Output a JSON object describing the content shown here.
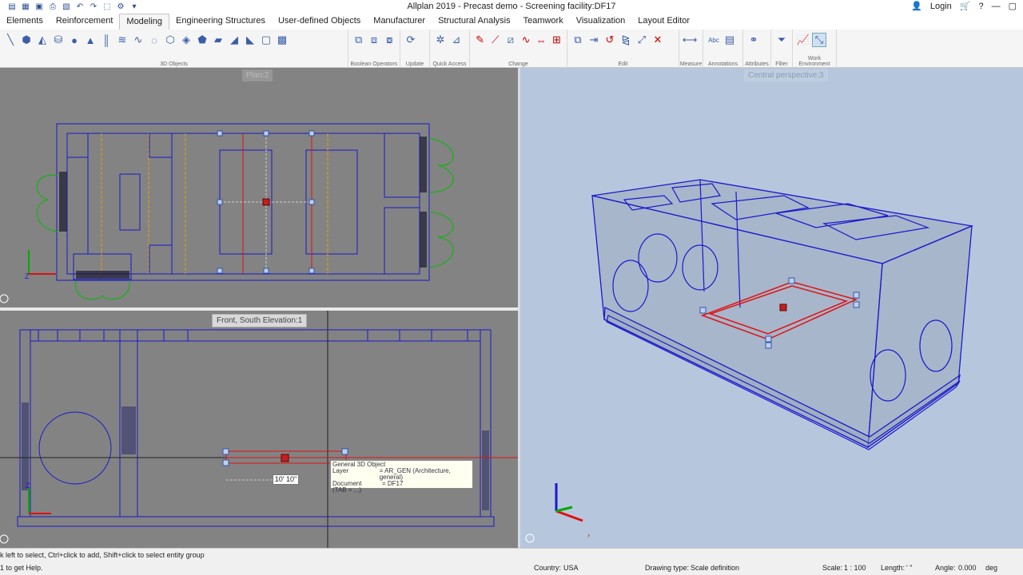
{
  "window": {
    "title": "Allplan 2019 - Precast demo - Screening facility:DF17",
    "login_label": "Login"
  },
  "menu": {
    "tabs": [
      "Elements",
      "Reinforcement",
      "Modeling",
      "Engineering Structures",
      "User-defined Objects",
      "Manufacturer",
      "Structural Analysis",
      "Teamwork",
      "Visualization",
      "Layout Editor"
    ],
    "active": "Modeling"
  },
  "ribbon": {
    "groups": [
      "3D Objects",
      "Boolean Operators",
      "Update",
      "Quick Access",
      "Change",
      "Edit",
      "Measure",
      "Annotations",
      "Attributes",
      "Filter",
      "Work Environment"
    ]
  },
  "viewports": {
    "plan_label": "Plan:2",
    "front_label": "Front, South Elevation:1",
    "persp_label": "Central perspective:3"
  },
  "tooltip": {
    "title": "General 3D Object",
    "layer_key": "Layer",
    "layer_val": "= AR_GEN (Architecture, general)",
    "doc_key": "Document",
    "doc_val": "= DF17",
    "tab_hint": "(TAB = ...)"
  },
  "dimension": "10' 10\"",
  "status": {
    "hint": "k left to select, Ctrl+click to add, Shift+click to select entity group",
    "help": "1 to get Help.",
    "country_label": "Country:",
    "country": "USA",
    "drawing_type_label": "Drawing type:",
    "drawing_type": "Scale definition",
    "scale_label": "Scale:",
    "scale": "1 : 100",
    "length_label": "Length:",
    "length": "' \"",
    "angle_label": "Angle:",
    "angle": "0.000",
    "angle_unit": "deg"
  },
  "colors": {
    "model_lines": "#1a1acc",
    "selection": "#e01010",
    "axis_green": "#00aa00"
  }
}
